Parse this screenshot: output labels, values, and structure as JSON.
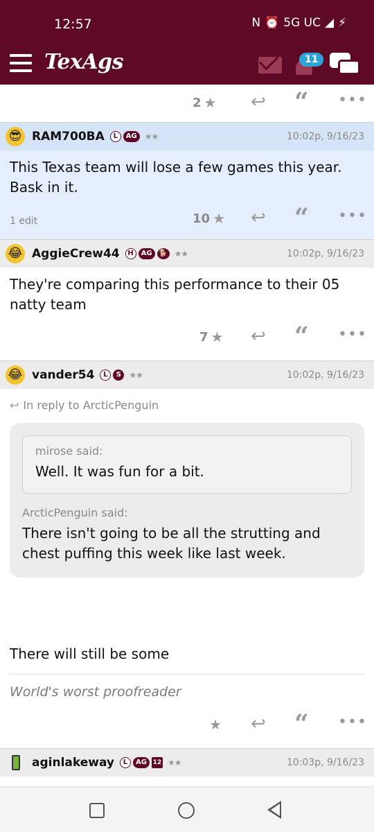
{
  "status_bar": {
    "time": "12:57",
    "network": "5G UC"
  },
  "app": {
    "logo": "TexAgs",
    "notification_count": "11"
  },
  "top_actions": {
    "count": "2"
  },
  "posts": [
    {
      "username": "RAM700BA",
      "badges": [
        "L",
        "AG"
      ],
      "time": "10:02p, 9/16/23",
      "body": "This Texas team will lose a few games this year. Bask in it.",
      "edit_note": "1 edit",
      "star_count": "10"
    },
    {
      "username": "AggieCrew44",
      "badges": [
        "H",
        "AG"
      ],
      "time": "10:02p, 9/16/23",
      "body": "They're comparing this performance to their 05 natty team",
      "star_count": "7"
    },
    {
      "username": "vander54",
      "badges": [
        "L",
        "S"
      ],
      "time": "10:02p, 9/16/23",
      "reply_to": "In reply to ArcticPenguin",
      "inner_quote_author": "mirose said:",
      "inner_quote_text": "Well. It was fun for a bit.",
      "outer_quote_author": "ArcticPenguin said:",
      "outer_quote_text": "There isn't going to be all the strutting and chest puffing this week like last week.",
      "body": "There will still be some",
      "signature": "World's worst proofreader",
      "star_count": ""
    },
    {
      "username": "aginlakeway",
      "badges": [
        "L",
        "AG",
        "12"
      ],
      "time": "10:03p, 9/16/23"
    }
  ],
  "icons": {
    "menu": "hamburger-icon",
    "mail": "mail-icon",
    "bell": "bell-icon",
    "chat": "chat-icon",
    "star": "star-icon",
    "reply": "reply-icon",
    "quote": "quote-icon",
    "more": "more-icon"
  },
  "colors": {
    "brand": "#5e0a26",
    "badge_blue": "#2fa3d6",
    "highlight": "#e4eefc"
  }
}
